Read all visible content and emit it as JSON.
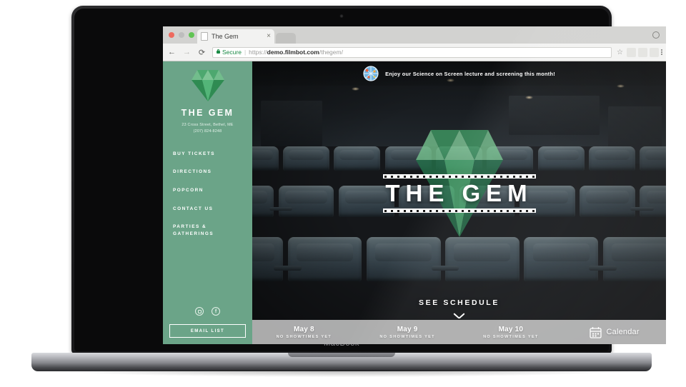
{
  "browser": {
    "tab_title": "The Gem",
    "tab_close": "×",
    "back_icon": "←",
    "forward_icon": "→",
    "reload_icon": "⟳",
    "secure_label": "Secure",
    "url_separator": "|",
    "url_scheme": "https://",
    "url_domain": "demo.filmbot.com",
    "url_path": "/thegem/",
    "star_icon": "☆",
    "ext_icons": [
      "◨",
      "▣",
      "g"
    ],
    "menu_icon": "⋮"
  },
  "device": {
    "model_label": "MacBook"
  },
  "sidebar": {
    "brand": "THE GEM",
    "address_line1": "23 Cross Street, Bethel, ME",
    "address_line2": "(207) 824-8248",
    "nav": [
      {
        "label": "BUY TICKETS"
      },
      {
        "label": "DIRECTIONS"
      },
      {
        "label": "POPCORN"
      },
      {
        "label": "CONTACT US"
      },
      {
        "label": "PARTIES &\nGATHERINGS"
      }
    ],
    "social": [
      {
        "name": "instagram",
        "glyph": ""
      },
      {
        "name": "facebook",
        "glyph": "f"
      }
    ],
    "email_button": "EMAIL LIST"
  },
  "hero": {
    "banner_text": "Enjoy our Science on Screen lecture and screening this month!",
    "banner_icon": "science-globe-icon",
    "logo_title": "THE GEM",
    "cta_label": "SEE SCHEDULE",
    "cta_icon": "chevron-down-icon"
  },
  "showtimes": {
    "days": [
      {
        "date": "May 8",
        "status": "NO SHOWTIMES YET"
      },
      {
        "date": "May 9",
        "status": "NO SHOWTIMES YET"
      },
      {
        "date": "May 10",
        "status": "NO SHOWTIMES YET"
      }
    ],
    "calendar_label": "Calendar",
    "calendar_icon": "calendar-icon"
  },
  "colors": {
    "sidebar_green": "#6ba488",
    "gem_light": "#79c291",
    "gem_mid": "#4ea56f",
    "gem_dark": "#2f7a4c",
    "secure_green": "#1a8a45",
    "showbar_gray": "#c1c1c1"
  }
}
